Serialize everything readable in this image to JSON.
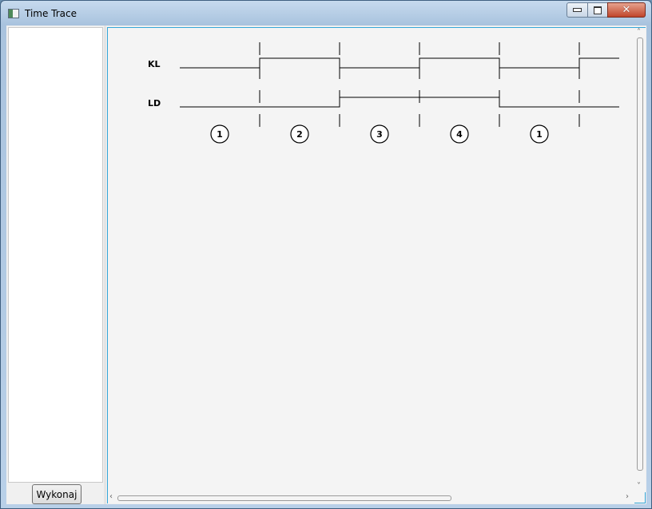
{
  "window": {
    "title": "Time Trace",
    "close_glyph": "✕"
  },
  "left_panel": {
    "execute_label": "Wykonaj"
  },
  "diagram": {
    "signals": [
      {
        "name": "KL",
        "levels": [
          0,
          1,
          0,
          1,
          0,
          1
        ]
      },
      {
        "name": "LD",
        "levels": [
          0,
          0,
          1,
          1,
          0,
          0
        ]
      }
    ],
    "states": [
      "1",
      "2",
      "3",
      "4",
      "1"
    ]
  },
  "scrollbars": {
    "up": "˄",
    "down": "˅",
    "left": "‹",
    "right": "›"
  },
  "colors": {
    "selection_border": "#33a6d8",
    "close_button": "#c0452a"
  }
}
